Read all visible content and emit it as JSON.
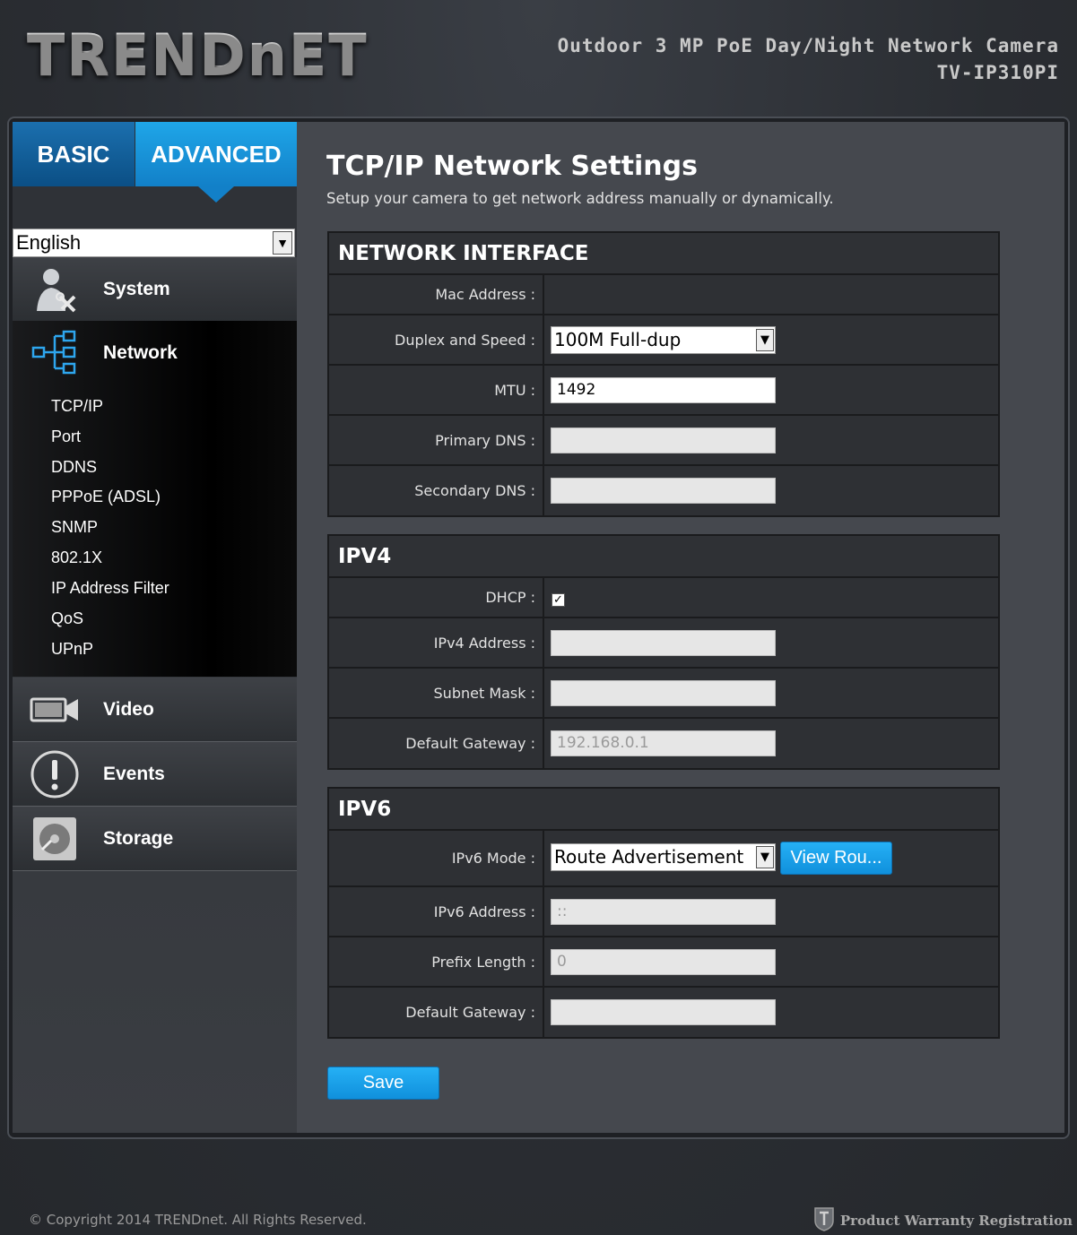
{
  "header": {
    "logo": "TRENDnET",
    "product_line1": "Outdoor 3 MP PoE Day/Night Network Camera",
    "product_line2": "TV-IP310PI"
  },
  "tabs": {
    "basic": "BASIC",
    "advanced": "ADVANCED"
  },
  "language": {
    "selected": "English"
  },
  "sidebar": {
    "system": "System",
    "network": "Network",
    "network_items": [
      "TCP/IP",
      "Port",
      "DDNS",
      "PPPoE (ADSL)",
      "SNMP",
      "802.1X",
      "IP Address Filter",
      "QoS",
      "UPnP"
    ],
    "video": "Video",
    "events": "Events",
    "storage": "Storage"
  },
  "page": {
    "title": "TCP/IP Network Settings",
    "description": "Setup your camera to get network address manually or dynamically."
  },
  "network_interface": {
    "heading": "NETWORK INTERFACE",
    "mac_label": "Mac Address :",
    "duplex_label": "Duplex and Speed :",
    "duplex_value": "100M Full-dup",
    "mtu_label": "MTU :",
    "mtu_value": "1492",
    "primary_dns_label": "Primary DNS :",
    "secondary_dns_label": "Secondary DNS :"
  },
  "ipv4": {
    "heading": "IPV4",
    "dhcp_label": "DHCP :",
    "dhcp_checked": "✓",
    "address_label": "IPv4 Address :",
    "subnet_label": "Subnet Mask :",
    "gateway_label": "Default Gateway :",
    "gateway_value": "192.168.0.1"
  },
  "ipv6": {
    "heading": "IPV6",
    "mode_label": "IPv6 Mode :",
    "mode_value": "Route Advertisement",
    "view_button": "View Rou...",
    "address_label": "IPv6 Address :",
    "address_value": "::",
    "prefix_label": "Prefix Length :",
    "prefix_value": "0",
    "gateway_label": "Default Gateway :"
  },
  "actions": {
    "save": "Save"
  },
  "footer": {
    "copyright": "© Copyright 2014 TRENDnet. All Rights Reserved.",
    "registration": "Product Warranty Registration"
  },
  "colors": {
    "accent": "#1a9ee6",
    "tab_basic": "#0b4f85",
    "content_bg": "#45484e"
  },
  "icons": [
    "system-icon",
    "network-icon",
    "video-icon",
    "events-icon",
    "storage-icon",
    "shield-logo-icon"
  ]
}
